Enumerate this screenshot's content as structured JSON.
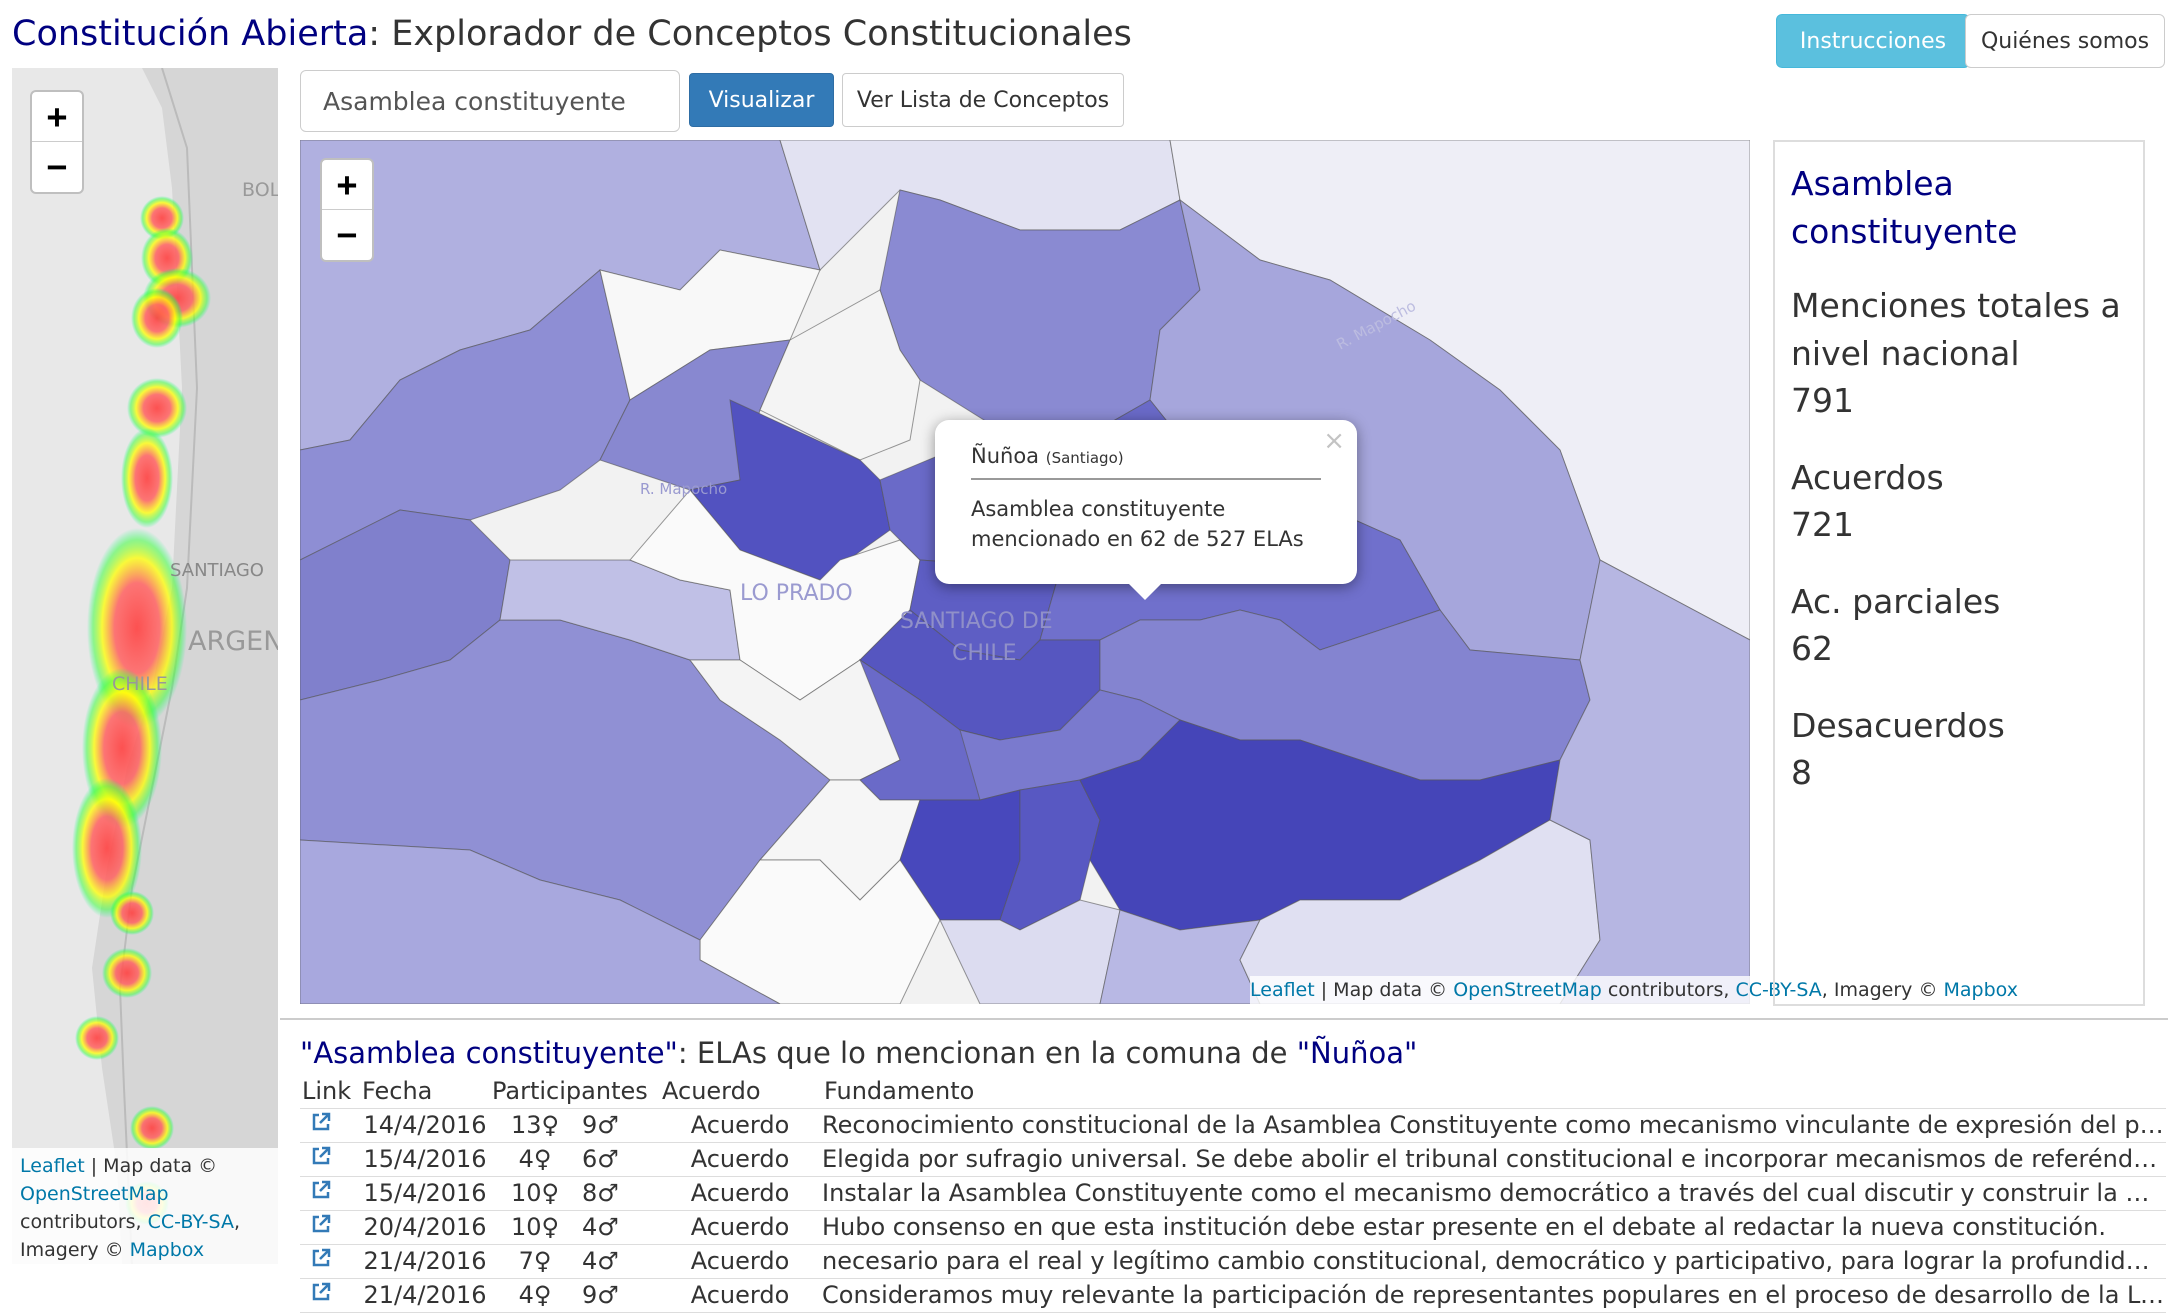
{
  "header": {
    "brand": "Constitución Abierta",
    "subtitle": ": Explorador de Conceptos Constitucionales",
    "instrucciones": "Instrucciones",
    "quienes": "Quiénes somos"
  },
  "search": {
    "value": "Asamblea constituyente",
    "visualize": "Visualizar",
    "list": "Ver Lista de Conceptos"
  },
  "left_map": {
    "zoom_in": "+",
    "zoom_out": "−",
    "labels": {
      "bol": "BOL",
      "santiago": "SANTIAGO",
      "argen": "ARGEN",
      "chile": "CHILE"
    },
    "attribution": {
      "leaflet": "Leaflet",
      "mapdata": " | Map data © ",
      "osm": "OpenStreetMap",
      "contributors": " contributors, ",
      "license": "CC-BY-SA",
      "imagery": ", Imagery © ",
      "mapbox": "Mapbox"
    }
  },
  "main_map": {
    "zoom_in": "+",
    "zoom_out": "−",
    "labels": {
      "lo_prado": "LO PRADO",
      "santiago_de": "SANTIAGO DE",
      "chile": "CHILE",
      "mapocho1": "R. Mapocho",
      "mapocho2": "R. Mapocho"
    },
    "attribution": {
      "leaflet": "Leaflet",
      "mapdata": " | Map data © ",
      "osm": "OpenStreetMap",
      "contributors": " contributors, ",
      "license": "CC-BY-SA",
      "imagery": ", Imagery © ",
      "mapbox": "Mapbox"
    },
    "popup": {
      "comuna": "Ñuñoa",
      "region": "(Santiago)",
      "close": "×",
      "line1": "Asamblea constituyente",
      "line2": "mencionado en 62 de 527 ELAs"
    }
  },
  "panel": {
    "title": "Asamblea constituyente",
    "total_label": "Menciones totales a nivel nacional",
    "total_value": "791",
    "acuerdos_label": "Acuerdos",
    "acuerdos_value": "721",
    "parciales_label": "Ac. parciales",
    "parciales_value": "62",
    "desacuerdos_label": "Desacuerdos",
    "desacuerdos_value": "8"
  },
  "table": {
    "concept": "\"Asamblea constituyente\"",
    "middle": ": ELAs que lo mencionan en la comuna de ",
    "comuna": "\"Ñuñoa\"",
    "headers": {
      "link": "Link",
      "fecha": "Fecha",
      "participantes": "Participantes",
      "acuerdo": "Acuerdo",
      "fundamento": "Fundamento"
    },
    "rows": [
      {
        "fecha": "14/4/2016",
        "mujeres": "13♀",
        "hombres": "9♂",
        "acuerdo": "Acuerdo",
        "fundamento": "Reconocimiento constitucional de la Asamblea Constituyente como mecanismo vinculante de expresión del poder c..."
      },
      {
        "fecha": "15/4/2016",
        "mujeres": "4♀",
        "hombres": "6♂",
        "acuerdo": "Acuerdo",
        "fundamento": "Elegida por sufragio universal. Se debe abolir el tribunal constitucional e incorporar mecanismos de referéndum rev..."
      },
      {
        "fecha": "15/4/2016",
        "mujeres": "10♀",
        "hombres": "8♂",
        "acuerdo": "Acuerdo",
        "fundamento": "Instalar la Asamblea Constituyente como el mecanismo democrático a través del cual discutir y construir la nueva ca..."
      },
      {
        "fecha": "20/4/2016",
        "mujeres": "10♀",
        "hombres": "4♂",
        "acuerdo": "Acuerdo",
        "fundamento": "Hubo consenso en que esta institución debe estar presente en el debate al redactar la nueva constitución."
      },
      {
        "fecha": "21/4/2016",
        "mujeres": "7♀",
        "hombres": "4♂",
        "acuerdo": "Acuerdo",
        "fundamento": "necesario para el real y legítimo cambio constitucional, democrático y participativo, para lograr la profundidad que l..."
      },
      {
        "fecha": "21/4/2016",
        "mujeres": "4♀",
        "hombres": "9♂",
        "acuerdo": "Acuerdo",
        "fundamento": "Consideramos muy relevante la participación de representantes populares en el proceso de desarrollo de la Ley fun..."
      }
    ]
  },
  "colors": {
    "brand": "#000080",
    "link": "#337ab7",
    "info": "#5bc0de",
    "primary": "#337ab7",
    "choropleth_dark": "#4646b8",
    "choropleth_light": "#dadaf0"
  }
}
